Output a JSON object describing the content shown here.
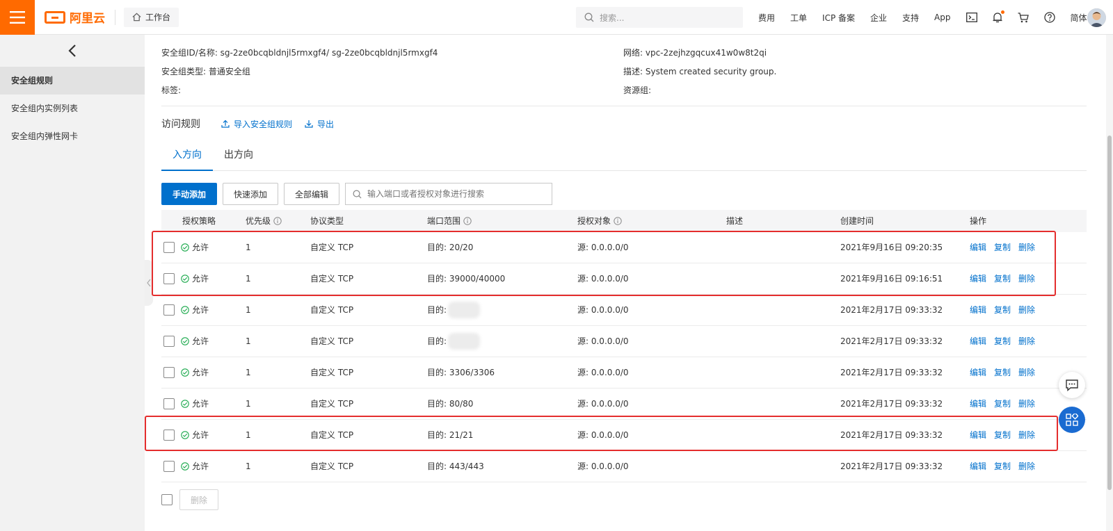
{
  "topbar": {
    "logo_text": "阿里云",
    "workbench_label": "工作台",
    "search_placeholder": "搜索...",
    "nav_items": [
      "费用",
      "工单",
      "ICP 备案",
      "企业",
      "支持",
      "App"
    ],
    "lang_label": "简体",
    "accent_color": "#ff6a00"
  },
  "sidebar": {
    "items": [
      {
        "label": "安全组规则",
        "active": true
      },
      {
        "label": "安全组内实例列表",
        "active": false
      },
      {
        "label": "安全组内弹性网卡",
        "active": false
      }
    ]
  },
  "info": {
    "id_name": "安全组ID/名称:  sg-2ze0bcqbldnjl5rmxgf4/ sg-2ze0bcqbldnjl5rmxgf4",
    "type": "安全组类型:  普通安全组",
    "tags": "标签:",
    "network": "网络:  vpc-2zejhzgqcux41w0w8t2qi",
    "description": "描述:  System created security group.",
    "resource_group": "资源组:"
  },
  "rules": {
    "title": "访问规则",
    "import_label": "导入安全组规则",
    "export_label": "导出"
  },
  "tabs": [
    {
      "label": "入方向",
      "active": true
    },
    {
      "label": "出方向",
      "active": false
    }
  ],
  "toolbar": {
    "manual_add": "手动添加",
    "quick_add": "快速添加",
    "edit_all": "全部编辑",
    "search_placeholder": "输入端口或者授权对象进行搜索"
  },
  "table": {
    "headers": {
      "policy": "授权策略",
      "priority": "优先级",
      "protocol": "协议类型",
      "port": "端口范围",
      "source": "授权对象",
      "desc": "描述",
      "created": "创建时间",
      "ops": "操作"
    },
    "rows": [
      {
        "policy": "允许",
        "priority": "1",
        "protocol": "自定义 TCP",
        "port": "目的: 20/20",
        "source": "源: 0.0.0.0/0",
        "desc": "",
        "created": "2021年9月16日 09:20:35"
      },
      {
        "policy": "允许",
        "priority": "1",
        "protocol": "自定义 TCP",
        "port": "目的: 39000/40000",
        "source": "源: 0.0.0.0/0",
        "desc": "",
        "created": "2021年9月16日 09:16:51"
      },
      {
        "policy": "允许",
        "priority": "1",
        "protocol": "自定义 TCP",
        "port": "目的:",
        "source": "源: 0.0.0.0/0",
        "desc": "",
        "created": "2021年2月17日 09:33:32"
      },
      {
        "policy": "允许",
        "priority": "1",
        "protocol": "自定义 TCP",
        "port": "目的:",
        "source": "源: 0.0.0.0/0",
        "desc": "",
        "created": "2021年2月17日 09:33:32"
      },
      {
        "policy": "允许",
        "priority": "1",
        "protocol": "自定义 TCP",
        "port": "目的: 3306/3306",
        "source": "源: 0.0.0.0/0",
        "desc": "",
        "created": "2021年2月17日 09:33:32"
      },
      {
        "policy": "允许",
        "priority": "1",
        "protocol": "自定义 TCP",
        "port": "目的: 80/80",
        "source": "源: 0.0.0.0/0",
        "desc": "",
        "created": "2021年2月17日 09:33:32"
      },
      {
        "policy": "允许",
        "priority": "1",
        "protocol": "自定义 TCP",
        "port": "目的: 21/21",
        "source": "源: 0.0.0.0/0",
        "desc": "",
        "created": "2021年2月17日 09:33:32"
      },
      {
        "policy": "允许",
        "priority": "1",
        "protocol": "自定义 TCP",
        "port": "目的: 443/443",
        "source": "源: 0.0.0.0/0",
        "desc": "",
        "created": "2021年2月17日 09:33:32"
      }
    ],
    "ops": {
      "edit": "编辑",
      "copy": "复制",
      "delete": "删除"
    }
  },
  "footer": {
    "delete_label": "删除"
  }
}
